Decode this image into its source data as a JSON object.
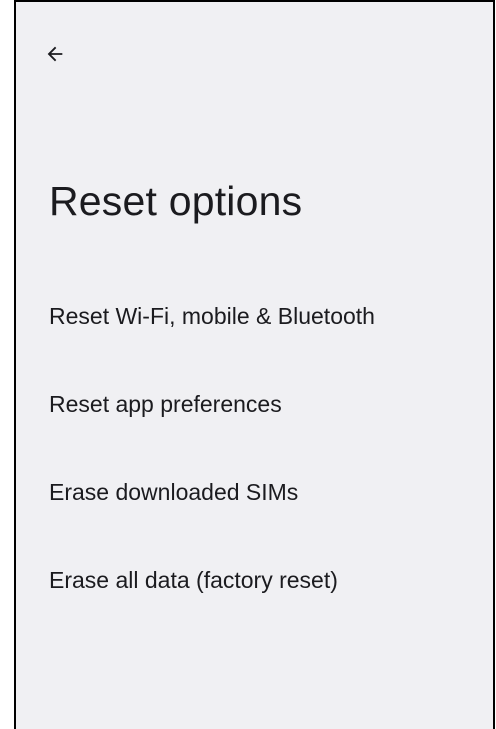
{
  "header": {
    "back_icon": "arrow-back-icon",
    "title": "Reset options"
  },
  "options": [
    {
      "label": "Reset Wi-Fi, mobile & Bluetooth"
    },
    {
      "label": "Reset app preferences"
    },
    {
      "label": "Erase downloaded SIMs"
    },
    {
      "label": "Erase all data (factory reset)"
    }
  ],
  "colors": {
    "background": "#f0f0f3",
    "text": "#1b1b1f"
  }
}
